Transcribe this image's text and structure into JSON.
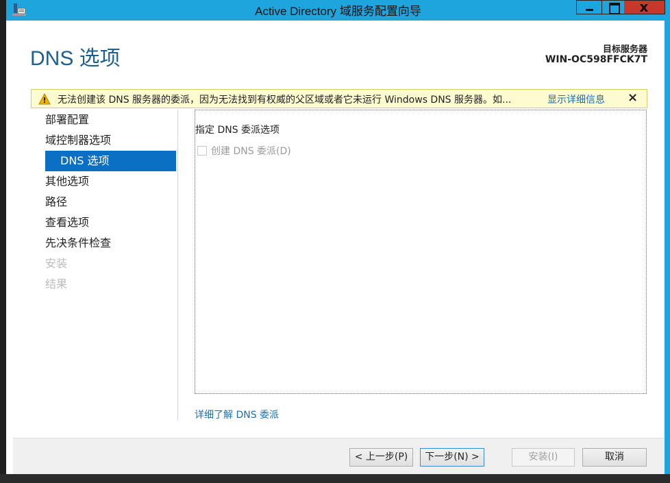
{
  "window": {
    "title": "Active Directory 域服务配置向导",
    "close_glyph": "x"
  },
  "header": {
    "page_title": "DNS 选项",
    "target_server_label": "目标服务器",
    "target_server_name": "WIN-OC598FFCK7T"
  },
  "warning": {
    "message": "无法创建该 DNS 服务器的委派，因为无法找到有权威的父区域或者它未运行 Windows DNS 服务器。如...",
    "details_link": "显示详细信息",
    "close_glyph": "×"
  },
  "nav": {
    "items": [
      {
        "label": "部署配置",
        "state": "normal"
      },
      {
        "label": "域控制器选项",
        "state": "normal"
      },
      {
        "label": "DNS 选项",
        "state": "selected"
      },
      {
        "label": "其他选项",
        "state": "normal"
      },
      {
        "label": "路径",
        "state": "normal"
      },
      {
        "label": "查看选项",
        "state": "normal"
      },
      {
        "label": "先决条件检查",
        "state": "normal"
      },
      {
        "label": "安装",
        "state": "disabled"
      },
      {
        "label": "结果",
        "state": "disabled"
      }
    ]
  },
  "main": {
    "section_label": "指定 DNS 委派选项",
    "create_delegation_label": "创建 DNS 委派(D)",
    "create_delegation_checked": false,
    "learn_more_link": "详细了解 DNS 委派"
  },
  "footer": {
    "prev_label": "< 上一步(P)",
    "next_label": "下一步(N) >",
    "install_label": "安装(I)",
    "cancel_label": "取消"
  },
  "colors": {
    "frame": "#1fa5dd",
    "selected_nav": "#0b6fc4",
    "title_blue": "#1d5f8f",
    "link": "#1a6fb0",
    "warning_bg": "#fdfbd0"
  }
}
